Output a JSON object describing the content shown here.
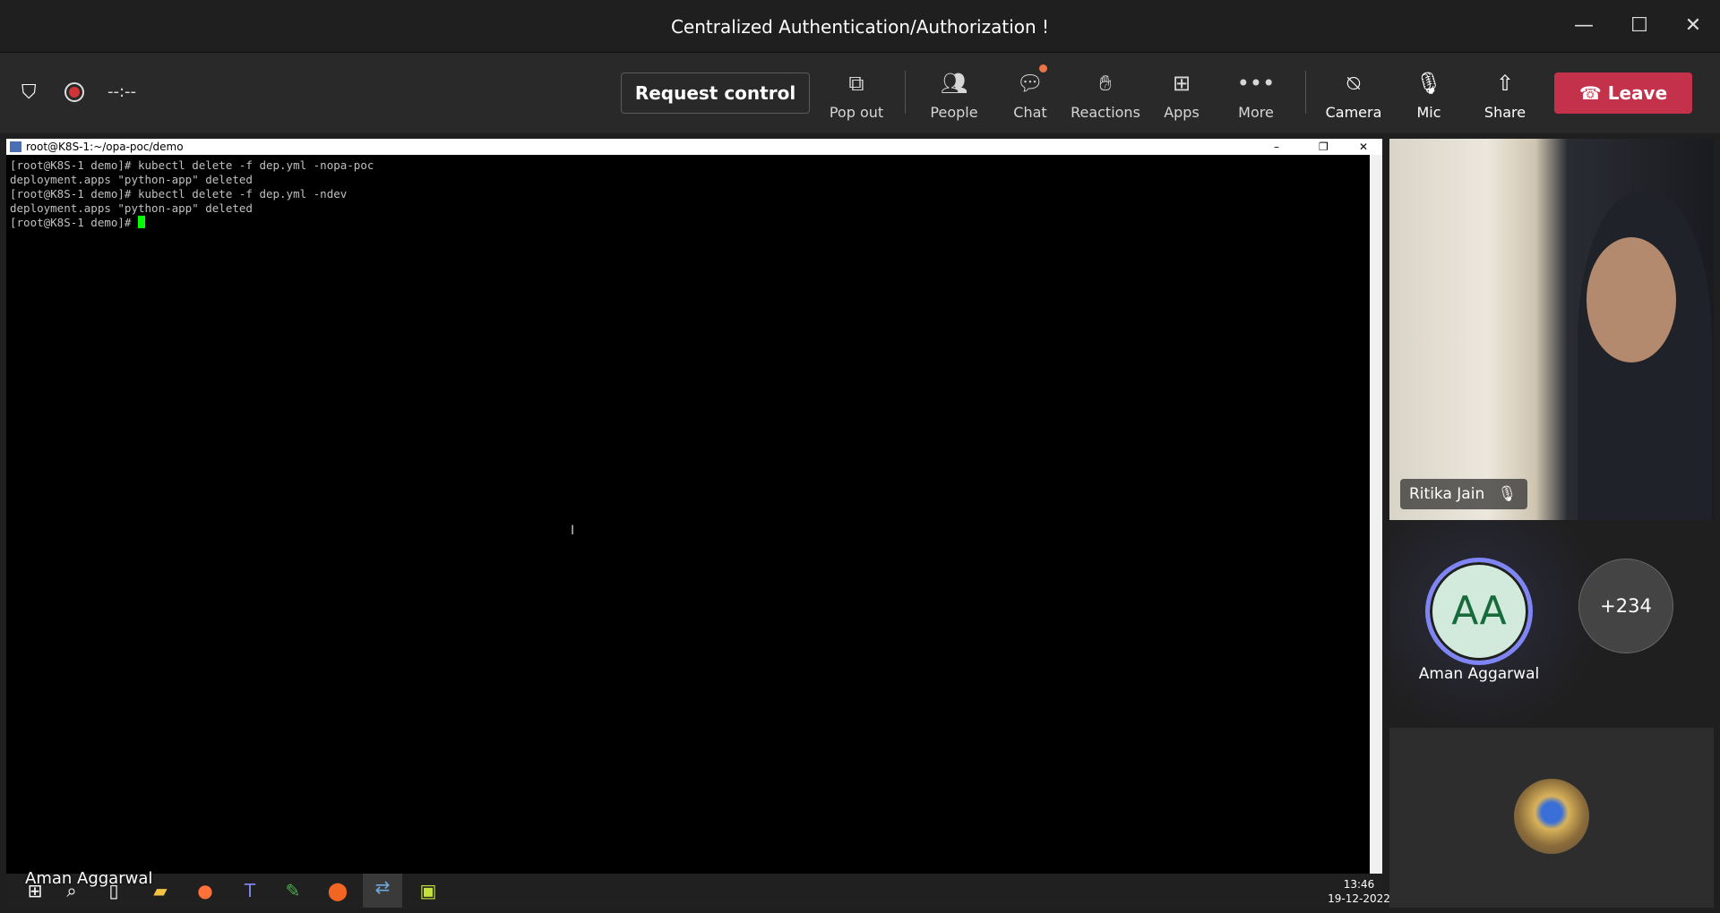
{
  "window": {
    "title": "Centralized Authentication/Authorization !",
    "minimize": "—",
    "maximize": "☐",
    "close": "✕"
  },
  "toolbar": {
    "timer": "--:--",
    "request_control": "Request control",
    "buttons": [
      {
        "label": "Pop out",
        "icon": "pop-out-icon"
      },
      {
        "label": "People",
        "icon": "people-icon"
      },
      {
        "label": "Chat",
        "icon": "chat-icon"
      },
      {
        "label": "Reactions",
        "icon": "reactions-icon"
      },
      {
        "label": "Apps",
        "icon": "apps-icon"
      },
      {
        "label": "More",
        "icon": "more-icon"
      },
      {
        "label": "Camera",
        "icon": "camera-off-icon"
      },
      {
        "label": "Mic",
        "icon": "mic-off-icon"
      },
      {
        "label": "Share",
        "icon": "share-icon"
      }
    ],
    "leave": "Leave",
    "leave_color": "#c4314b"
  },
  "terminal": {
    "title": "root@K8S-1:~/opa-poc/demo",
    "lines": [
      "[root@K8S-1 demo]# kubectl delete -f dep.yml -nopa-poc",
      "deployment.apps \"python-app\" deleted",
      "[root@K8S-1 demo]# kubectl delete -f dep.yml -ndev",
      "deployment.apps \"python-app\" deleted",
      "[root@K8S-1 demo]# "
    ]
  },
  "participants": {
    "video_name": "Ritika Jain",
    "avatar_initials": "AA",
    "avatar_name": "Aman Aggarwal",
    "overflow_count": "+234",
    "presenter_label": "Aman Aggarwal"
  },
  "taskbar": {
    "time": "13:46",
    "date": "19-12-2022"
  }
}
